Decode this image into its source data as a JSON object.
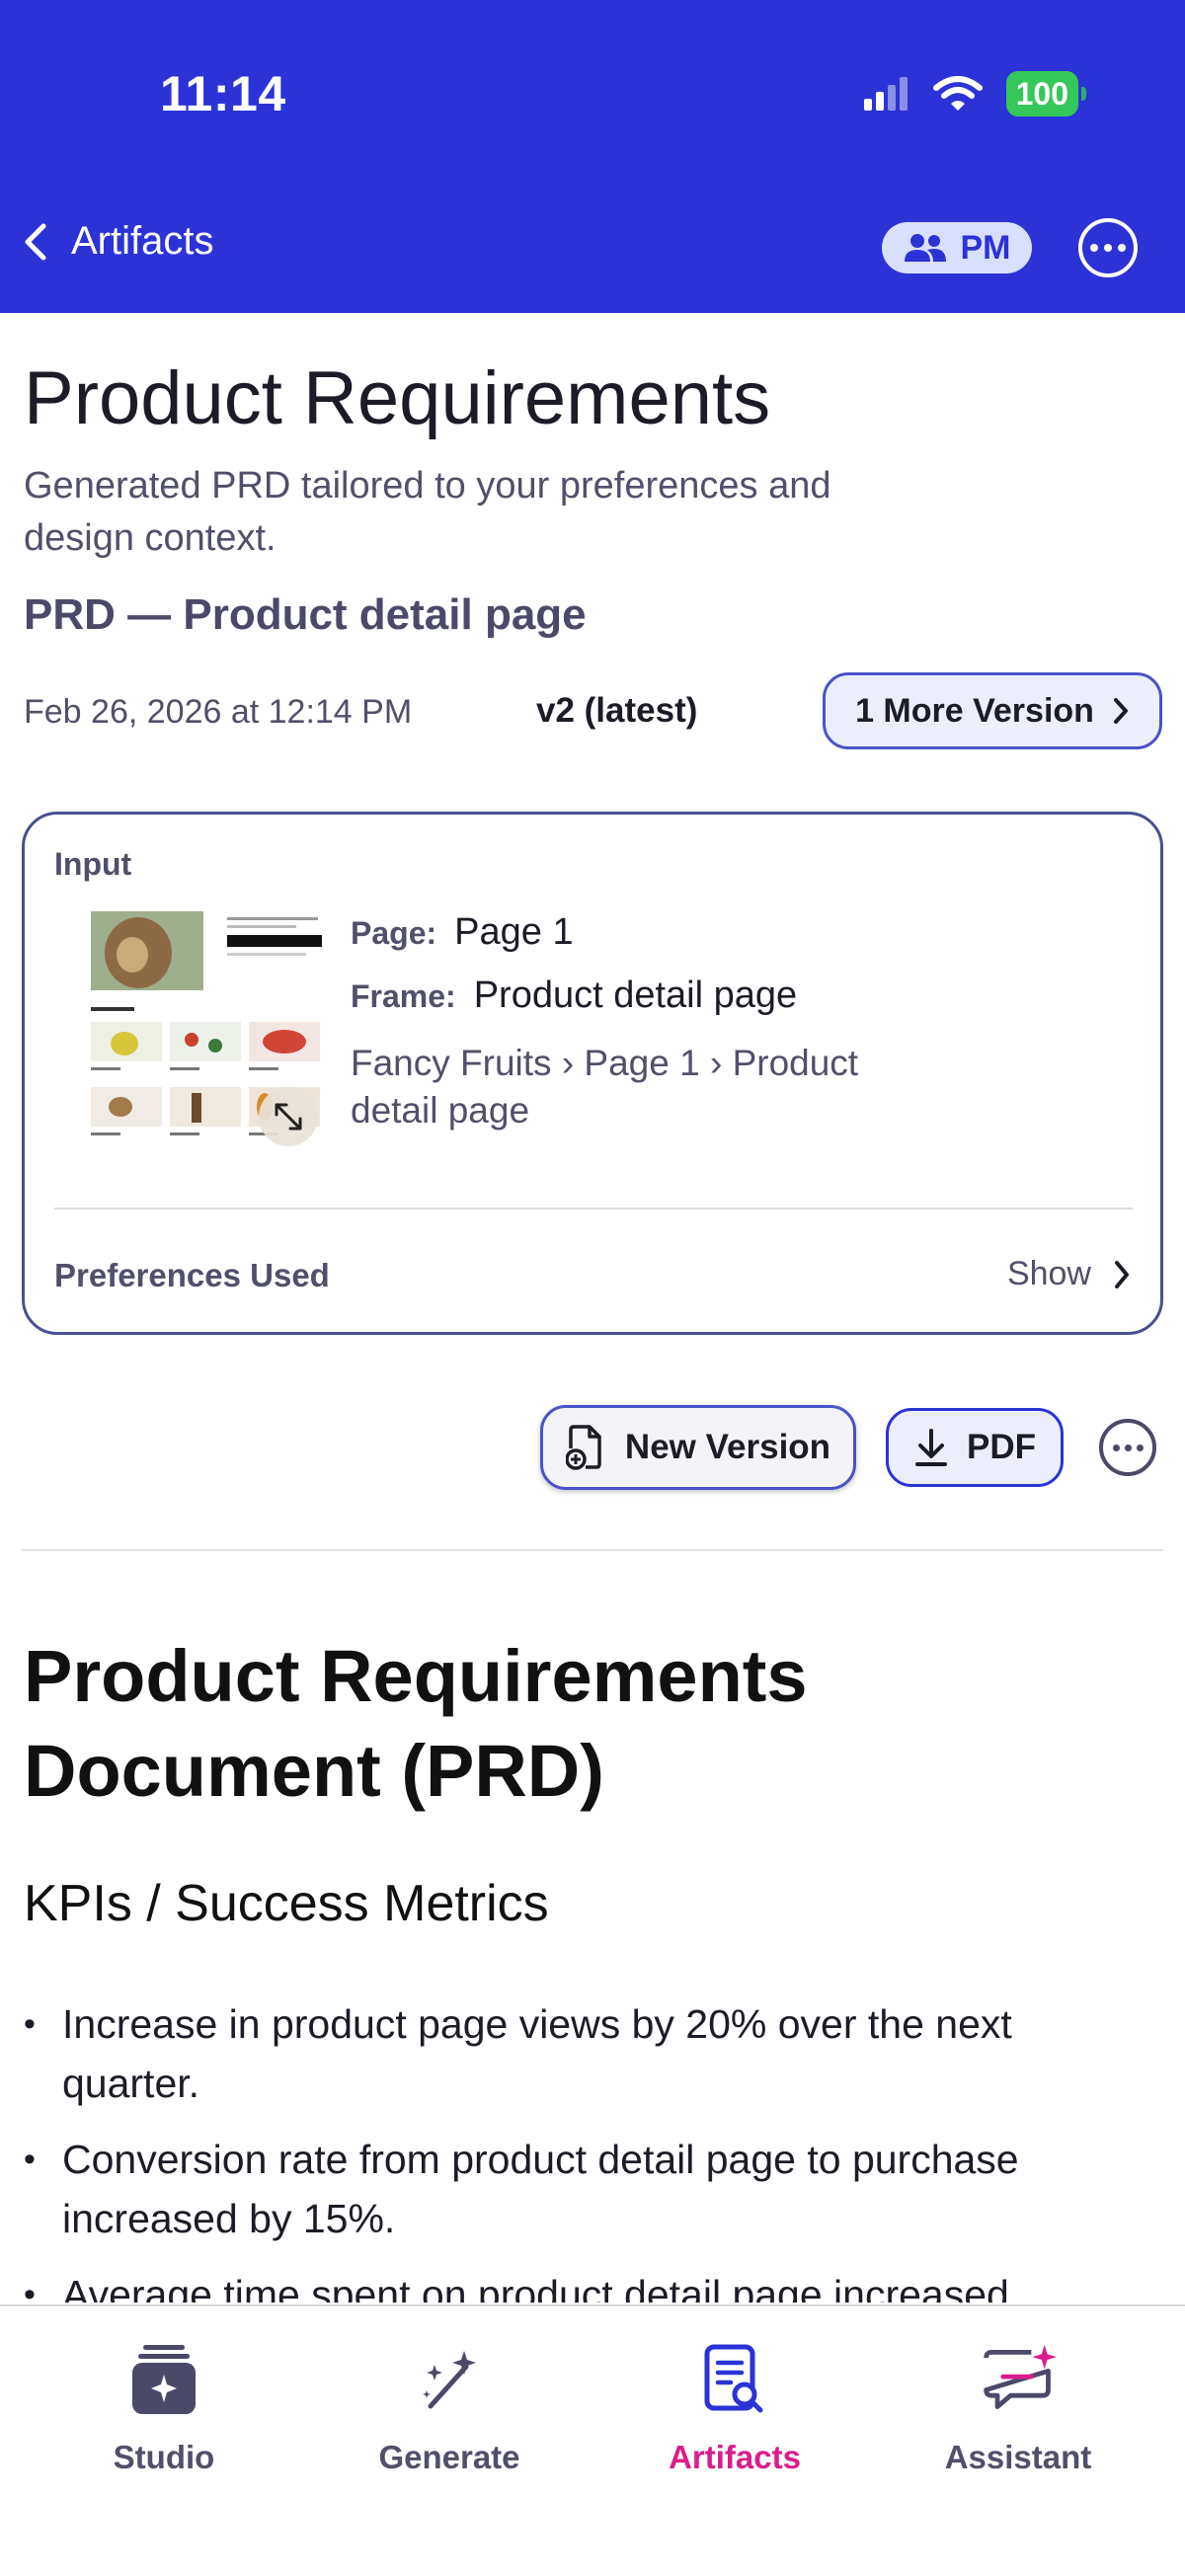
{
  "status_bar": {
    "time": "11:14",
    "battery": "100"
  },
  "header": {
    "back_label": "Artifacts",
    "role_badge": "PM"
  },
  "page": {
    "title": "Product Requirements",
    "subtitle": "Generated PRD tailored to your preferences and design context.",
    "document_name": "PRD — Product detail page",
    "date": "Feb 26, 2026 at 12:14 PM",
    "version": "v2 (latest)",
    "more_versions_label": "1 More Version"
  },
  "input_card": {
    "label": "Input",
    "page_key": "Page:",
    "page_value": "Page 1",
    "frame_key": "Frame:",
    "frame_value": "Product detail page",
    "path": "Fancy Fruits  ›  Page 1  ›  Product detail page",
    "preferences_label": "Preferences Used",
    "show_label": "Show"
  },
  "actions": {
    "new_version": "New Version",
    "pdf": "PDF"
  },
  "document": {
    "h1": "Product Requirements Document (PRD)",
    "h2": "KPIs / Success Metrics",
    "bullets": [
      "Increase in product page views by 20% over the next quarter.",
      "Conversion rate from product detail page to purchase increased by 15%.",
      "Average time spent on product detail page increased"
    ]
  },
  "tabs": [
    {
      "label": "Studio",
      "icon": "studio-icon"
    },
    {
      "label": "Generate",
      "icon": "magic-wand-icon"
    },
    {
      "label": "Artifacts",
      "icon": "document-search-icon",
      "active": true
    },
    {
      "label": "Assistant",
      "icon": "chat-sparkle-icon"
    }
  ],
  "colors": {
    "header": "#2b33d6",
    "accent_active": "#d91e8b",
    "battery": "#34c759"
  }
}
